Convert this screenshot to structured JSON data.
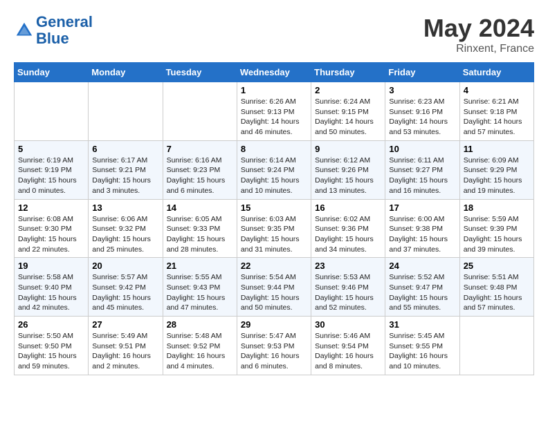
{
  "header": {
    "logo_line1": "General",
    "logo_line2": "Blue",
    "month": "May 2024",
    "location": "Rinxent, France"
  },
  "weekdays": [
    "Sunday",
    "Monday",
    "Tuesday",
    "Wednesday",
    "Thursday",
    "Friday",
    "Saturday"
  ],
  "weeks": [
    [
      {
        "day": "",
        "info": ""
      },
      {
        "day": "",
        "info": ""
      },
      {
        "day": "",
        "info": ""
      },
      {
        "day": "1",
        "info": "Sunrise: 6:26 AM\nSunset: 9:13 PM\nDaylight: 14 hours\nand 46 minutes."
      },
      {
        "day": "2",
        "info": "Sunrise: 6:24 AM\nSunset: 9:15 PM\nDaylight: 14 hours\nand 50 minutes."
      },
      {
        "day": "3",
        "info": "Sunrise: 6:23 AM\nSunset: 9:16 PM\nDaylight: 14 hours\nand 53 minutes."
      },
      {
        "day": "4",
        "info": "Sunrise: 6:21 AM\nSunset: 9:18 PM\nDaylight: 14 hours\nand 57 minutes."
      }
    ],
    [
      {
        "day": "5",
        "info": "Sunrise: 6:19 AM\nSunset: 9:19 PM\nDaylight: 15 hours\nand 0 minutes."
      },
      {
        "day": "6",
        "info": "Sunrise: 6:17 AM\nSunset: 9:21 PM\nDaylight: 15 hours\nand 3 minutes."
      },
      {
        "day": "7",
        "info": "Sunrise: 6:16 AM\nSunset: 9:23 PM\nDaylight: 15 hours\nand 6 minutes."
      },
      {
        "day": "8",
        "info": "Sunrise: 6:14 AM\nSunset: 9:24 PM\nDaylight: 15 hours\nand 10 minutes."
      },
      {
        "day": "9",
        "info": "Sunrise: 6:12 AM\nSunset: 9:26 PM\nDaylight: 15 hours\nand 13 minutes."
      },
      {
        "day": "10",
        "info": "Sunrise: 6:11 AM\nSunset: 9:27 PM\nDaylight: 15 hours\nand 16 minutes."
      },
      {
        "day": "11",
        "info": "Sunrise: 6:09 AM\nSunset: 9:29 PM\nDaylight: 15 hours\nand 19 minutes."
      }
    ],
    [
      {
        "day": "12",
        "info": "Sunrise: 6:08 AM\nSunset: 9:30 PM\nDaylight: 15 hours\nand 22 minutes."
      },
      {
        "day": "13",
        "info": "Sunrise: 6:06 AM\nSunset: 9:32 PM\nDaylight: 15 hours\nand 25 minutes."
      },
      {
        "day": "14",
        "info": "Sunrise: 6:05 AM\nSunset: 9:33 PM\nDaylight: 15 hours\nand 28 minutes."
      },
      {
        "day": "15",
        "info": "Sunrise: 6:03 AM\nSunset: 9:35 PM\nDaylight: 15 hours\nand 31 minutes."
      },
      {
        "day": "16",
        "info": "Sunrise: 6:02 AM\nSunset: 9:36 PM\nDaylight: 15 hours\nand 34 minutes."
      },
      {
        "day": "17",
        "info": "Sunrise: 6:00 AM\nSunset: 9:38 PM\nDaylight: 15 hours\nand 37 minutes."
      },
      {
        "day": "18",
        "info": "Sunrise: 5:59 AM\nSunset: 9:39 PM\nDaylight: 15 hours\nand 39 minutes."
      }
    ],
    [
      {
        "day": "19",
        "info": "Sunrise: 5:58 AM\nSunset: 9:40 PM\nDaylight: 15 hours\nand 42 minutes."
      },
      {
        "day": "20",
        "info": "Sunrise: 5:57 AM\nSunset: 9:42 PM\nDaylight: 15 hours\nand 45 minutes."
      },
      {
        "day": "21",
        "info": "Sunrise: 5:55 AM\nSunset: 9:43 PM\nDaylight: 15 hours\nand 47 minutes."
      },
      {
        "day": "22",
        "info": "Sunrise: 5:54 AM\nSunset: 9:44 PM\nDaylight: 15 hours\nand 50 minutes."
      },
      {
        "day": "23",
        "info": "Sunrise: 5:53 AM\nSunset: 9:46 PM\nDaylight: 15 hours\nand 52 minutes."
      },
      {
        "day": "24",
        "info": "Sunrise: 5:52 AM\nSunset: 9:47 PM\nDaylight: 15 hours\nand 55 minutes."
      },
      {
        "day": "25",
        "info": "Sunrise: 5:51 AM\nSunset: 9:48 PM\nDaylight: 15 hours\nand 57 minutes."
      }
    ],
    [
      {
        "day": "26",
        "info": "Sunrise: 5:50 AM\nSunset: 9:50 PM\nDaylight: 15 hours\nand 59 minutes."
      },
      {
        "day": "27",
        "info": "Sunrise: 5:49 AM\nSunset: 9:51 PM\nDaylight: 16 hours\nand 2 minutes."
      },
      {
        "day": "28",
        "info": "Sunrise: 5:48 AM\nSunset: 9:52 PM\nDaylight: 16 hours\nand 4 minutes."
      },
      {
        "day": "29",
        "info": "Sunrise: 5:47 AM\nSunset: 9:53 PM\nDaylight: 16 hours\nand 6 minutes."
      },
      {
        "day": "30",
        "info": "Sunrise: 5:46 AM\nSunset: 9:54 PM\nDaylight: 16 hours\nand 8 minutes."
      },
      {
        "day": "31",
        "info": "Sunrise: 5:45 AM\nSunset: 9:55 PM\nDaylight: 16 hours\nand 10 minutes."
      },
      {
        "day": "",
        "info": ""
      }
    ]
  ]
}
